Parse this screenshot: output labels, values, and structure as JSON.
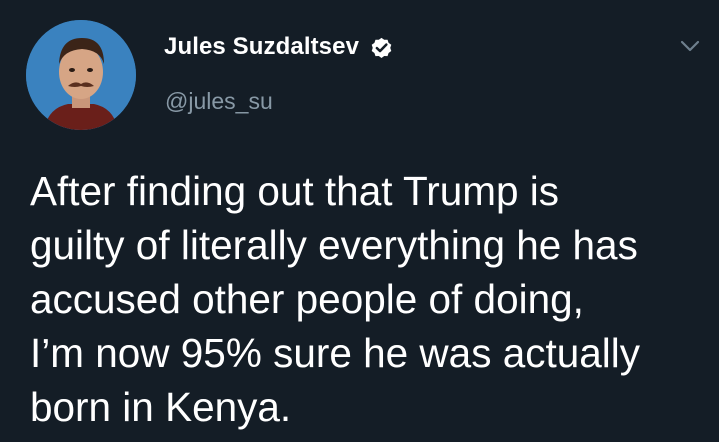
{
  "tweet": {
    "author": {
      "display_name": "Jules Suzdaltsev",
      "handle": "@jules_su",
      "verified": true,
      "avatar_icon": "profile-photo"
    },
    "menu_icon": "chevron-down-icon",
    "text_lines": [
      "After finding out that Trump is",
      "guilty of literally everything he has",
      "accused other people of doing,",
      "I’m now 95% sure he was actually",
      "born in Kenya."
    ]
  },
  "colors": {
    "background": "#141d26",
    "text": "#ffffff",
    "secondary_text": "#8899a6",
    "verified_badge": "#ffffff"
  }
}
